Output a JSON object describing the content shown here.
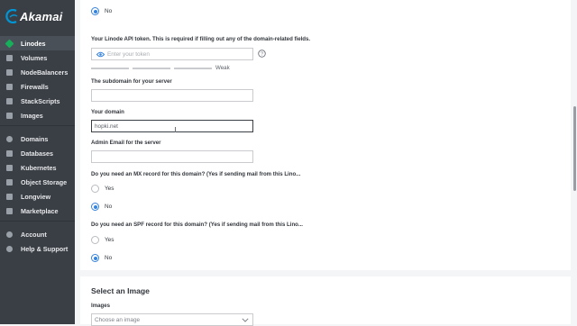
{
  "brand": {
    "name": "Akamai",
    "color": "#0096d6"
  },
  "sidebar": {
    "items": [
      {
        "label": "Linodes",
        "icon": "linode-icon",
        "active": true
      },
      {
        "label": "Volumes",
        "icon": "volume-icon"
      },
      {
        "label": "NodeBalancers",
        "icon": "nodebalancer-icon"
      },
      {
        "label": "Firewalls",
        "icon": "firewall-icon"
      },
      {
        "label": "StackScripts",
        "icon": "stackscript-icon"
      },
      {
        "label": "Images",
        "icon": "image-icon"
      },
      {
        "label": "Domains",
        "icon": "domain-icon"
      },
      {
        "label": "Databases",
        "icon": "database-icon"
      },
      {
        "label": "Kubernetes",
        "icon": "kubernetes-icon"
      },
      {
        "label": "Object Storage",
        "icon": "object-storage-icon"
      },
      {
        "label": "Longview",
        "icon": "longview-icon"
      },
      {
        "label": "Marketplace",
        "icon": "marketplace-icon"
      },
      {
        "label": "Account",
        "icon": "account-icon"
      },
      {
        "label": "Help & Support",
        "icon": "help-icon"
      }
    ]
  },
  "form": {
    "top_radio_no": "No",
    "token_label": "Your Linode API token. This is required if filling out any of the domain-related fields.",
    "token_placeholder": "Enter your token",
    "token_strength": "Weak",
    "subdomain_label": "The subdomain for your server",
    "subdomain_value": "",
    "domain_label": "Your domain",
    "domain_value": "hopki.net",
    "email_label": "Admin Email for the server",
    "email_value": "",
    "mx_label": "Do you need an MX record for this domain? (Yes if sending mail from this Lino...",
    "mx_yes": "Yes",
    "mx_no": "No",
    "mx_selected": "No",
    "spf_label": "Do you need an SPF record for this domain? (Yes if sending mail from this Lino...",
    "spf_yes": "Yes",
    "spf_no": "No",
    "spf_selected": "No"
  },
  "image_section": {
    "title": "Select an Image",
    "images_label": "Images",
    "images_placeholder": "Choose an image"
  },
  "colors": {
    "accent": "#3683dc",
    "sidebar_bg": "#3a3f46",
    "active_green": "#17b05a"
  }
}
